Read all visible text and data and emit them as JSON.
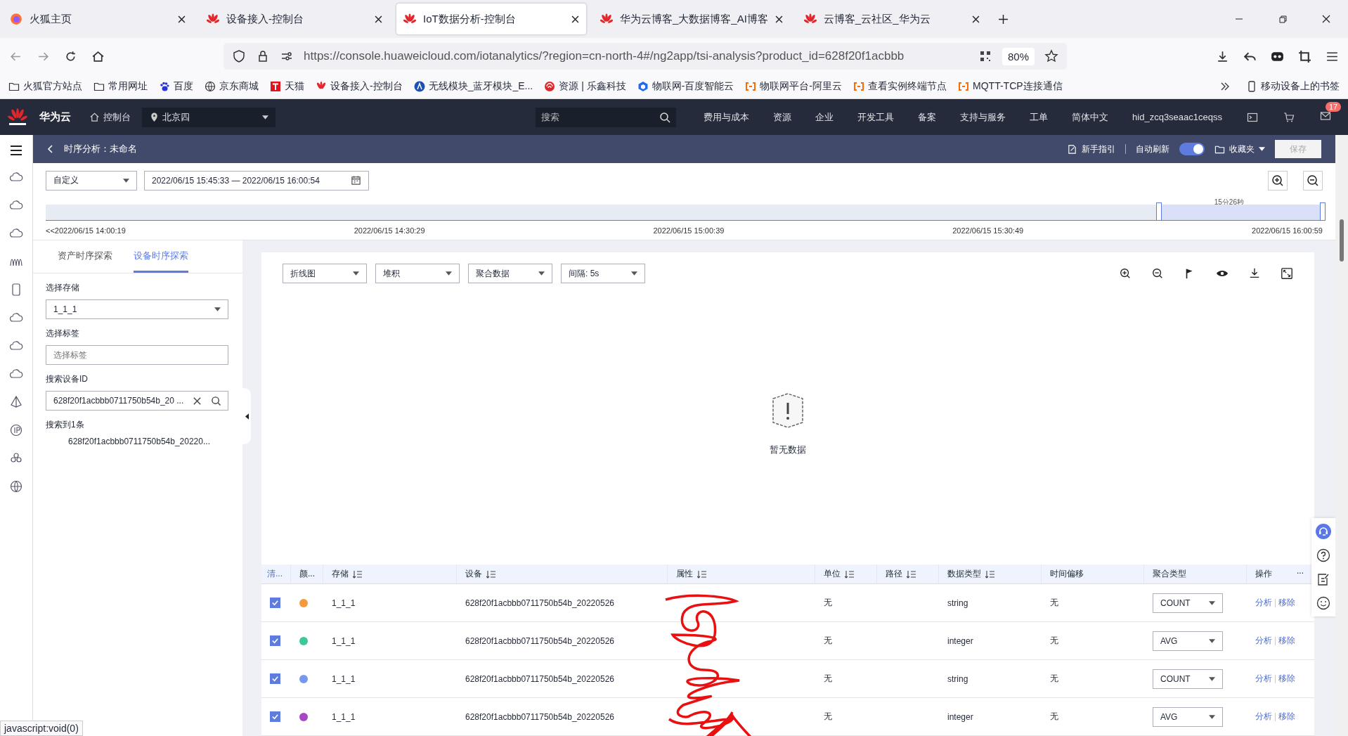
{
  "browser_tabs": [
    {
      "title": "火狐主页",
      "kind": "firefox",
      "selected": false
    },
    {
      "title": "设备接入-控制台",
      "kind": "huawei",
      "selected": false
    },
    {
      "title": "IoT数据分析-控制台",
      "kind": "huawei",
      "selected": true
    },
    {
      "title": "华为云博客_大数据博客_AI博客",
      "kind": "huawei",
      "selected": false
    },
    {
      "title": "云博客_云社区_华为云",
      "kind": "huawei",
      "selected": false
    }
  ],
  "address": {
    "url": "https://console.huaweicloud.com/iotanalytics/?region=cn-north-4#/ng2app/tsi-analysis?product_id=628f20f1acbbb",
    "zoom": "80%"
  },
  "bookmarks": [
    {
      "label": "火狐官方站点",
      "kind": "folder"
    },
    {
      "label": "常用网址",
      "kind": "folder"
    },
    {
      "label": "百度",
      "kind": "paw"
    },
    {
      "label": "京东商城",
      "kind": "globe"
    },
    {
      "label": "天猫",
      "kind": "square"
    },
    {
      "label": "设备接入-控制台",
      "kind": "huawei"
    },
    {
      "label": "无线模块_蓝牙模块_E...",
      "kind": "circle"
    },
    {
      "label": "资源 | 乐鑫科技",
      "kind": "swirl"
    },
    {
      "label": "物联网-百度智能云",
      "kind": "cube"
    },
    {
      "label": "物联网平台-阿里云",
      "kind": "bracket"
    },
    {
      "label": "查看实例终端节点",
      "kind": "bracket"
    },
    {
      "label": "MQTT-TCP连接通信",
      "kind": "bracket"
    }
  ],
  "mobile_bookmarks": "移动设备上的书签",
  "console_header": {
    "brand": "华为云",
    "console": "控制台",
    "region": "北京四",
    "search_placeholder": "搜索",
    "nav": [
      "费用与成本",
      "资源",
      "企业",
      "开发工具",
      "备案",
      "支持与服务",
      "工单",
      "简体中文",
      "hid_zcq3seaac1ceqss"
    ],
    "message_count": "17"
  },
  "sub_header": {
    "title": "时序分析：未命名",
    "guide": "新手指引",
    "auto_refresh": {
      "label": "自动刷新",
      "on": true
    },
    "favorites": "收藏夹",
    "save": {
      "label": "保存",
      "disabled": true
    }
  },
  "time_range": {
    "mode": "自定义",
    "range": "2022/06/15 15:45:33 — 2022/06/15 16:00:54"
  },
  "timeline": {
    "duration": "15分26秒",
    "labels": [
      "<<2022/06/15 14:00:19",
      "2022/06/15 14:30:29",
      "2022/06/15 15:00:39",
      "2022/06/15 15:30:49",
      "2022/06/15 16:00:59"
    ]
  },
  "left_panel": {
    "tabs": [
      {
        "label": "资产时序探索",
        "selected": false
      },
      {
        "label": "设备时序探索",
        "selected": true
      }
    ],
    "storage_label": "选择存储",
    "storage_value": "1_1_1",
    "tag_label": "选择标签",
    "tag_placeholder": "选择标签",
    "device_label": "搜索设备ID",
    "device_value": "628f20f1acbbb0711750b54b_20 ...",
    "result_count": "搜索到1条",
    "results": [
      "628f20f1acbbb0711750b54b_20220..."
    ]
  },
  "chart_toolbar": {
    "selects": [
      "折线图",
      "堆积",
      "聚合数据",
      "间隔: 5s"
    ]
  },
  "empty_text": "暂无数据",
  "table": {
    "columns": [
      {
        "label": "清...",
        "sortable": false
      },
      {
        "label": "颜...",
        "sortable": false
      },
      {
        "label": "存储",
        "sortable": true
      },
      {
        "label": "设备",
        "sortable": true
      },
      {
        "label": "属性",
        "sortable": true
      },
      {
        "label": "单位",
        "sortable": true
      },
      {
        "label": "路径",
        "sortable": true
      },
      {
        "label": "数据类型",
        "sortable": true
      },
      {
        "label": "时间偏移",
        "sortable": false
      },
      {
        "label": "聚合类型",
        "sortable": false
      },
      {
        "label": "操作",
        "sortable": false
      }
    ],
    "more": "...",
    "rows": [
      {
        "checked": true,
        "color": "#f5983f",
        "storage": "1_1_1",
        "device": "628f20f1acbbb0711750b54b_20220526",
        "unit": "无",
        "data_type": "string",
        "offset": "无",
        "aggregation": "COUNT",
        "actions": [
          "分析",
          "移除"
        ]
      },
      {
        "checked": true,
        "color": "#3cc79a",
        "storage": "1_1_1",
        "device": "628f20f1acbbb0711750b54b_20220526",
        "unit": "无",
        "data_type": "integer",
        "offset": "无",
        "aggregation": "AVG",
        "actions": [
          "分析",
          "移除"
        ]
      },
      {
        "checked": true,
        "color": "#7897ef",
        "storage": "1_1_1",
        "device": "628f20f1acbbb0711750b54b_20220526",
        "unit": "无",
        "data_type": "string",
        "offset": "无",
        "aggregation": "COUNT",
        "actions": [
          "分析",
          "移除"
        ]
      },
      {
        "checked": true,
        "color": "#a648c4",
        "storage": "1_1_1",
        "device": "628f20f1acbbb0711750b54b_20220526",
        "unit": "无",
        "data_type": "integer",
        "offset": "无",
        "aggregation": "AVG",
        "actions": [
          "分析",
          "移除"
        ]
      }
    ]
  },
  "status_bar": "javascript:void(0)"
}
